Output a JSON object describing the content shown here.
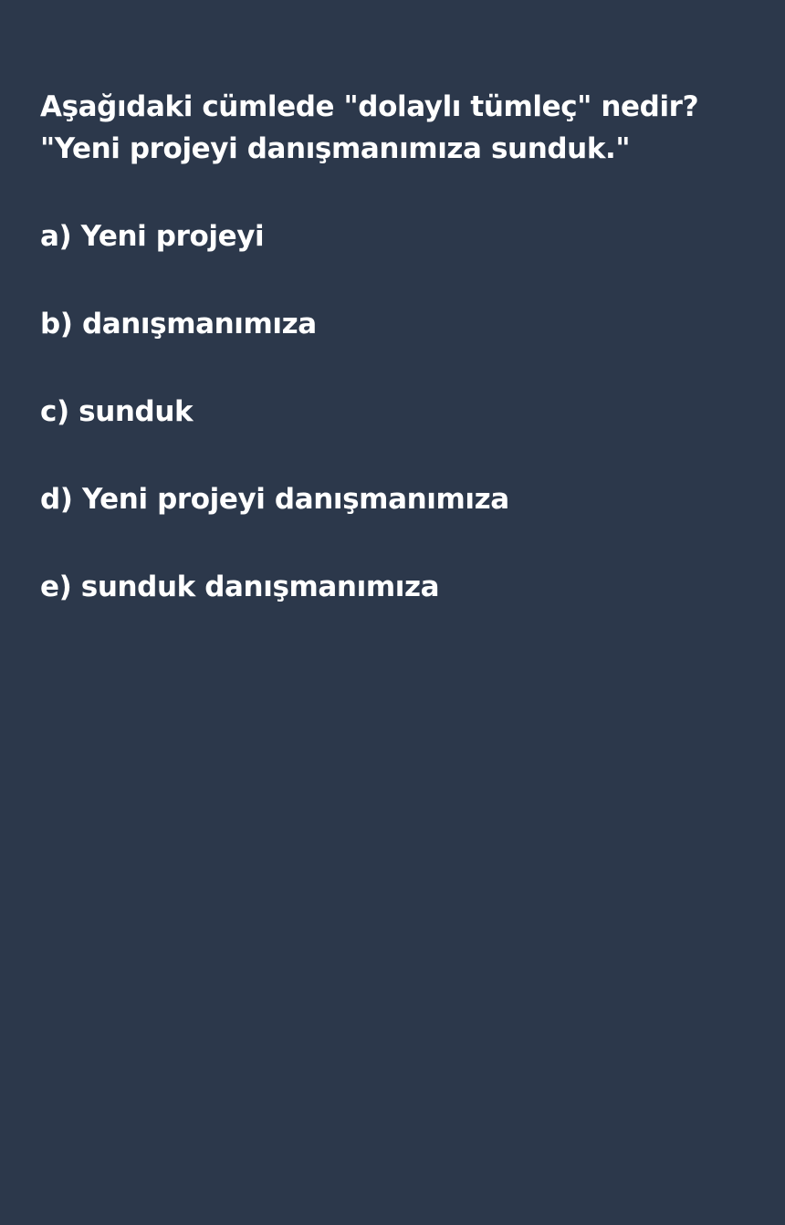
{
  "question": {
    "line1": "Aşağıdaki cümlede \"dolaylı tümleç\" nedir?",
    "line2": "\"Yeni projeyi danışmanımıza sunduk.\""
  },
  "options": [
    {
      "label": "a) Yeni projeyi"
    },
    {
      "label": "b) danışmanımıza"
    },
    {
      "label": "c) sunduk"
    },
    {
      "label": "d) Yeni projeyi danışmanımıza"
    },
    {
      "label": "e) sunduk danışmanımıza"
    }
  ],
  "colors": {
    "background": "#2c384b",
    "text": "#ffffff"
  }
}
